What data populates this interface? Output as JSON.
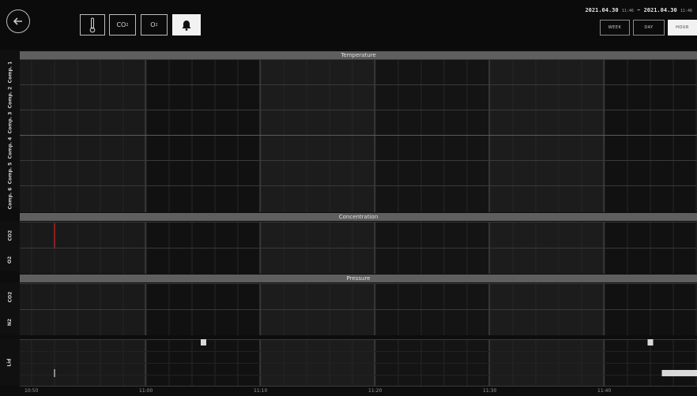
{
  "toolbar": {
    "back_icon": "arrow-left-icon",
    "buttons": [
      {
        "id": "temperature",
        "icon": "thermometer-icon",
        "label": ""
      },
      {
        "id": "co2",
        "label": "CO",
        "sub": "2"
      },
      {
        "id": "o2",
        "label": "O",
        "sub": "2"
      },
      {
        "id": "alarm",
        "icon": "bell-icon",
        "label": "",
        "active": true
      }
    ]
  },
  "range": {
    "start_date": "2021.04.30",
    "start_time": "11:46",
    "separator": "~",
    "end_date": "2021.04.30",
    "end_time": "11:46",
    "buttons": [
      {
        "label": "WEEK"
      },
      {
        "label": "DAY"
      },
      {
        "label": "HOUR",
        "active": true
      }
    ]
  },
  "sections": {
    "temperature": {
      "title": "Temperature",
      "rows": [
        "Comp. 1",
        "Comp. 2",
        "Comp. 3",
        "Comp. 4",
        "Comp. 5",
        "Comp. 6"
      ]
    },
    "concentration": {
      "title": "Concentration",
      "rows": [
        "CO2",
        "O2"
      ]
    },
    "pressure": {
      "title": "Pressure",
      "rows": [
        "CO2",
        "N2"
      ]
    },
    "lid": {
      "rows": [
        "Lid"
      ]
    }
  },
  "x_axis": {
    "ticks": [
      "10:50",
      "11:00",
      "11:10",
      "11:20",
      "11:30",
      "11:40"
    ]
  },
  "events": {
    "co2_concentration_marker_x": "10:52",
    "lid_markers": [
      {
        "x": "11:05"
      },
      {
        "x": "11:44"
      }
    ],
    "lid_low_marker_x": "10:52",
    "lid_bar_start": "11:45"
  },
  "colors": {
    "event_red": "#d62424",
    "band_dark": "#141414",
    "band_mid": "#1c1c1c",
    "header_gray": "#5f5f5f"
  }
}
